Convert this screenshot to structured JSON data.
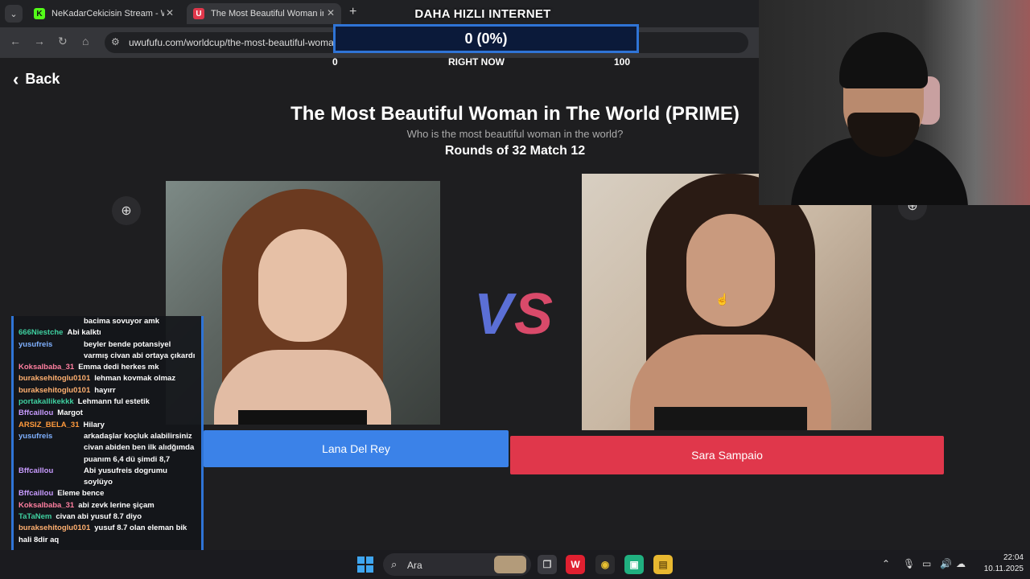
{
  "browser": {
    "tabs": [
      {
        "favicon": "K",
        "title": "NeKadarCekicisin Stream - Watch",
        "active": false
      },
      {
        "favicon": "U",
        "title": "The Most Beautiful Woman in The",
        "active": true
      }
    ],
    "new_tab_icon": "+",
    "url": "uwufufu.com/worldcup/the-most-beautiful-woma"
  },
  "overlay": {
    "title": "DAHA HIZLI INTERNET",
    "value_text": "0 (0%)",
    "progress_percent": 0,
    "min_label": "0",
    "mid_label": "RIGHT NOW",
    "max_label": "100"
  },
  "page": {
    "back_label": "Back",
    "title": "The Most Beautiful Woman in The World (PRIME)",
    "subtitle": "Who is the most beautiful woman in the world?",
    "round_info": "Rounds of 32 Match 12",
    "vs_v": "V",
    "vs_s": "S",
    "left_choice": "Lana Del Rey",
    "right_choice": "Sara Sampaio",
    "colors": {
      "left": "#3b82e8",
      "right": "#e0374b",
      "background": "#1e1e20"
    }
  },
  "chat": {
    "messages": [
      {
        "user": "",
        "color": "#ffffff",
        "text": "bacima sovuyor amk",
        "indent": true
      },
      {
        "user": "666Niestche",
        "color": "#3fd0a0",
        "text": "Abi kalktı",
        "indent": false
      },
      {
        "user": "yusufreis",
        "color": "#7fb0ff",
        "text": "beyler bende potansiyel varmış civan abi ortaya çıkardı",
        "indent": true
      },
      {
        "user": "Koksalbaba_31",
        "color": "#ff7fa0",
        "text": "Emma dedi herkes mk",
        "indent": false
      },
      {
        "user": "buraksehitoglu0101",
        "color": "#ffb070",
        "text": "lehman kovmak olmaz",
        "indent": false
      },
      {
        "user": "buraksehitoglu0101",
        "color": "#ffb070",
        "text": "hayırr",
        "indent": false
      },
      {
        "user": "portakallikekkk",
        "color": "#3fd0a0",
        "text": "Lehmann ful estetik",
        "indent": false
      },
      {
        "user": "Bffcaillou",
        "color": "#c89bff",
        "text": "Margot",
        "indent": false
      },
      {
        "user": "ARSIZ_BELA_31",
        "color": "#ff9a3c",
        "text": "Hilary",
        "indent": false
      },
      {
        "user": "yusufreis",
        "color": "#7fb0ff",
        "text": "arkadaşlar koçluk alabilirsiniz civan abiden ben ilk alıdğımda puanım 6,4 dü şimdi 8,7",
        "indent": true
      },
      {
        "user": "Bffcaillou",
        "color": "#c89bff",
        "text": "Abi yusufreis dogrumu soylüyo",
        "indent": true
      },
      {
        "user": "Bffcaillou",
        "color": "#c89bff",
        "text": "Eleme bence",
        "indent": false
      },
      {
        "user": "Koksalbaba_31",
        "color": "#ff7fa0",
        "text": "abi zevk lerine şiçam",
        "indent": false
      },
      {
        "user": "TaTaNem",
        "color": "#3fd0a0",
        "text": "civan abi yusuf 8.7 diyo",
        "indent": false
      },
      {
        "user": "buraksehitoglu0101",
        "color": "#ffb070",
        "text": "yusuf 8.7 olan eleman bik hali 8dir aq",
        "indent": false
      }
    ]
  },
  "taskbar": {
    "search_placeholder": "Ara",
    "time": "22:04",
    "date": "10.11.2025"
  }
}
